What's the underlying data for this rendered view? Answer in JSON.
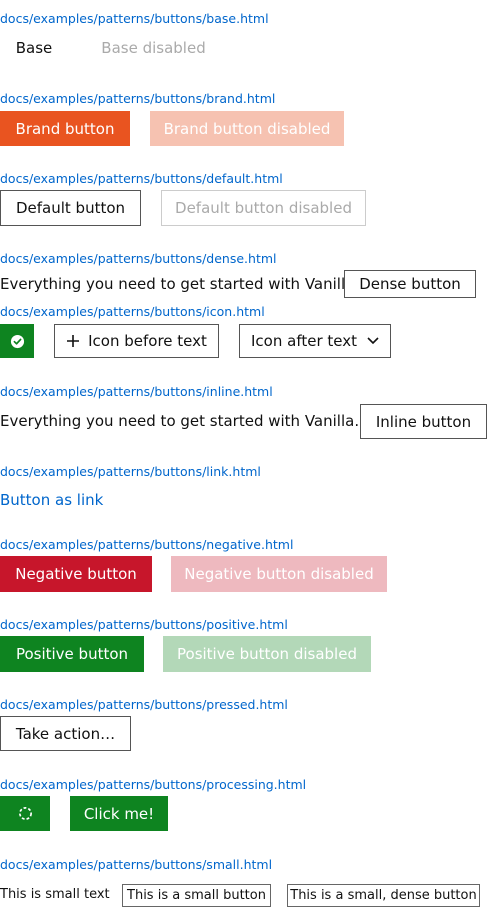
{
  "sections": {
    "base": {
      "path": "docs/examples/patterns/buttons/base.html",
      "button": "Base",
      "button_disabled": "Base disabled"
    },
    "brand": {
      "path": "docs/examples/patterns/buttons/brand.html",
      "button": "Brand button",
      "button_disabled": "Brand button disabled"
    },
    "default": {
      "path": "docs/examples/patterns/buttons/default.html",
      "button": "Default button",
      "button_disabled": "Default button disabled"
    },
    "dense": {
      "path": "docs/examples/patterns/buttons/dense.html",
      "text": "Everything you need to get started with Vanilla.",
      "button": "Dense button"
    },
    "icon": {
      "path": "docs/examples/patterns/buttons/icon.html",
      "icon_only": "check-circle-icon",
      "icon_before": "Icon before text",
      "icon_after": "Icon after text"
    },
    "inline": {
      "path": "docs/examples/patterns/buttons/inline.html",
      "text": "Everything you need to get started with Vanilla.",
      "button": "Inline button"
    },
    "link": {
      "path": "docs/examples/patterns/buttons/link.html",
      "button": "Button as link"
    },
    "negative": {
      "path": "docs/examples/patterns/buttons/negative.html",
      "button": "Negative button",
      "button_disabled": "Negative button disabled"
    },
    "positive": {
      "path": "docs/examples/patterns/buttons/positive.html",
      "button": "Positive button",
      "button_disabled": "Positive button disabled"
    },
    "pressed": {
      "path": "docs/examples/patterns/buttons/pressed.html",
      "button": "Take action…"
    },
    "processing": {
      "path": "docs/examples/patterns/buttons/processing.html",
      "spinner_icon": "spinner-icon",
      "button": "Click me!"
    },
    "small": {
      "path": "docs/examples/patterns/buttons/small.html",
      "text": "This is small text",
      "button": "This is a small button",
      "button_dense": "This is a small, dense button"
    }
  },
  "colors": {
    "link": "#0066cc",
    "brand": "#e95420",
    "negative": "#c7162b",
    "positive": "#0e8420"
  }
}
